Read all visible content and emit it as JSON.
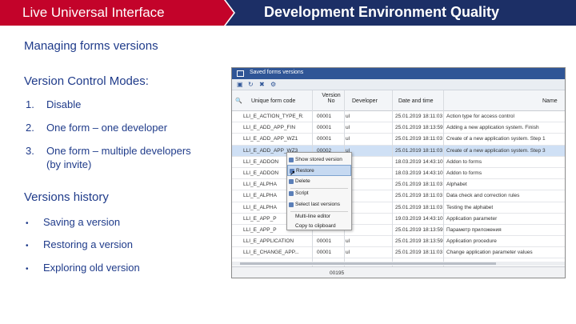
{
  "header": {
    "left_title": "Live Universal Interface",
    "right_title": "Development Environment Quality",
    "colors": {
      "left": "#c3032a",
      "right": "#1c2f66",
      "text": "#1f3b8a"
    }
  },
  "content": {
    "section1": "Managing forms versions",
    "section2": "Version Control Modes:",
    "modes": [
      {
        "num": "1.",
        "label": "Disable"
      },
      {
        "num": "2.",
        "label": "One form – one developer"
      },
      {
        "num": "3.",
        "label": "One form – multiple developers",
        "label2": "(by invite)"
      }
    ],
    "section3": "Versions history",
    "history": [
      {
        "bullet": "•",
        "label": "Saving a version"
      },
      {
        "bullet": "•",
        "label": "Restoring a version"
      },
      {
        "bullet": "•",
        "label": "Exploring old version"
      }
    ]
  },
  "window": {
    "title": "Saved forms versions",
    "columns": {
      "code": "Unique form code",
      "version": "Version No",
      "developer": "Developer",
      "datetime": "Date and time",
      "name": "Name"
    },
    "rows": [
      {
        "code": "LLI_E_ACTION_TYPE_R...",
        "version": "00001",
        "dev": "ul",
        "date": "25.01.2019 18:11:03",
        "name": "Action type for access control",
        "selected": false
      },
      {
        "code": "LLI_E_ADD_APP_FIN",
        "version": "00001",
        "dev": "ul",
        "date": "25.01.2019 18:13:59",
        "name": "Adding a new application system. Finish",
        "selected": false
      },
      {
        "code": "LLI_E_ADD_APP_WZ1",
        "version": "00001",
        "dev": "ul",
        "date": "25.01.2019 18:11:03",
        "name": "Create of a new application system. Step 1",
        "selected": false
      },
      {
        "code": "LLI_E_ADD_APP_WZ3",
        "version": "00002",
        "dev": "ul",
        "date": "25.01.2019 18:11:03",
        "name": "Create of a new application system. Step 3",
        "selected": true
      },
      {
        "code": "LLI_E_ADDON",
        "version": "",
        "dev": "",
        "date": "18.03.2019 14:43:10",
        "name": "Addon to forms",
        "selected": false
      },
      {
        "code": "LLI_E_ADDON",
        "version": "",
        "dev": "",
        "date": "18.03.2019 14:43:10",
        "name": "Addon to forms",
        "selected": false
      },
      {
        "code": "LLI_E_ALPHA",
        "version": "",
        "dev": "",
        "date": "25.01.2019 18:11:03",
        "name": "Alphabet",
        "selected": false
      },
      {
        "code": "LLI_E_ALPHA",
        "version": "",
        "dev": "",
        "date": "25.01.2019 18:11:03",
        "name": "Data check and correction rules",
        "selected": false
      },
      {
        "code": "LLI_E_ALPHA",
        "version": "",
        "dev": "",
        "date": "25.01.2019 18:11:03",
        "name": "Testing the alphabet",
        "selected": false
      },
      {
        "code": "LLI_E_APP_P",
        "version": "",
        "dev": "",
        "date": "19.03.2019 14:43:10",
        "name": "Application parameter",
        "selected": false
      },
      {
        "code": "LLI_E_APP_P",
        "version": "",
        "dev": "",
        "date": "25.01.2019 18:13:59",
        "name": "Параметр приложения",
        "selected": false
      },
      {
        "code": "LLI_E_APPLICATION",
        "version": "00001",
        "dev": "ul",
        "date": "25.01.2019 18:13:59",
        "name": "Application procedure",
        "selected": false
      },
      {
        "code": "LLI_E_CHANGE_APP...",
        "version": "00001",
        "dev": "ul",
        "date": "25.01.2019 18:11:03",
        "name": "Change application parameter values",
        "selected": false
      }
    ],
    "footer_count": "00195",
    "context_menu": [
      {
        "label": "Show stored version",
        "highlighted": false
      },
      {
        "label": "Restore",
        "highlighted": true
      },
      {
        "label": "Delete",
        "highlighted": false
      },
      {
        "label": "Script",
        "highlighted": false
      },
      {
        "label": "Select last versions",
        "highlighted": false
      },
      {
        "label": "Multi-line editor",
        "highlighted": false
      },
      {
        "label": "Copy to clipboard",
        "highlighted": false
      }
    ]
  }
}
